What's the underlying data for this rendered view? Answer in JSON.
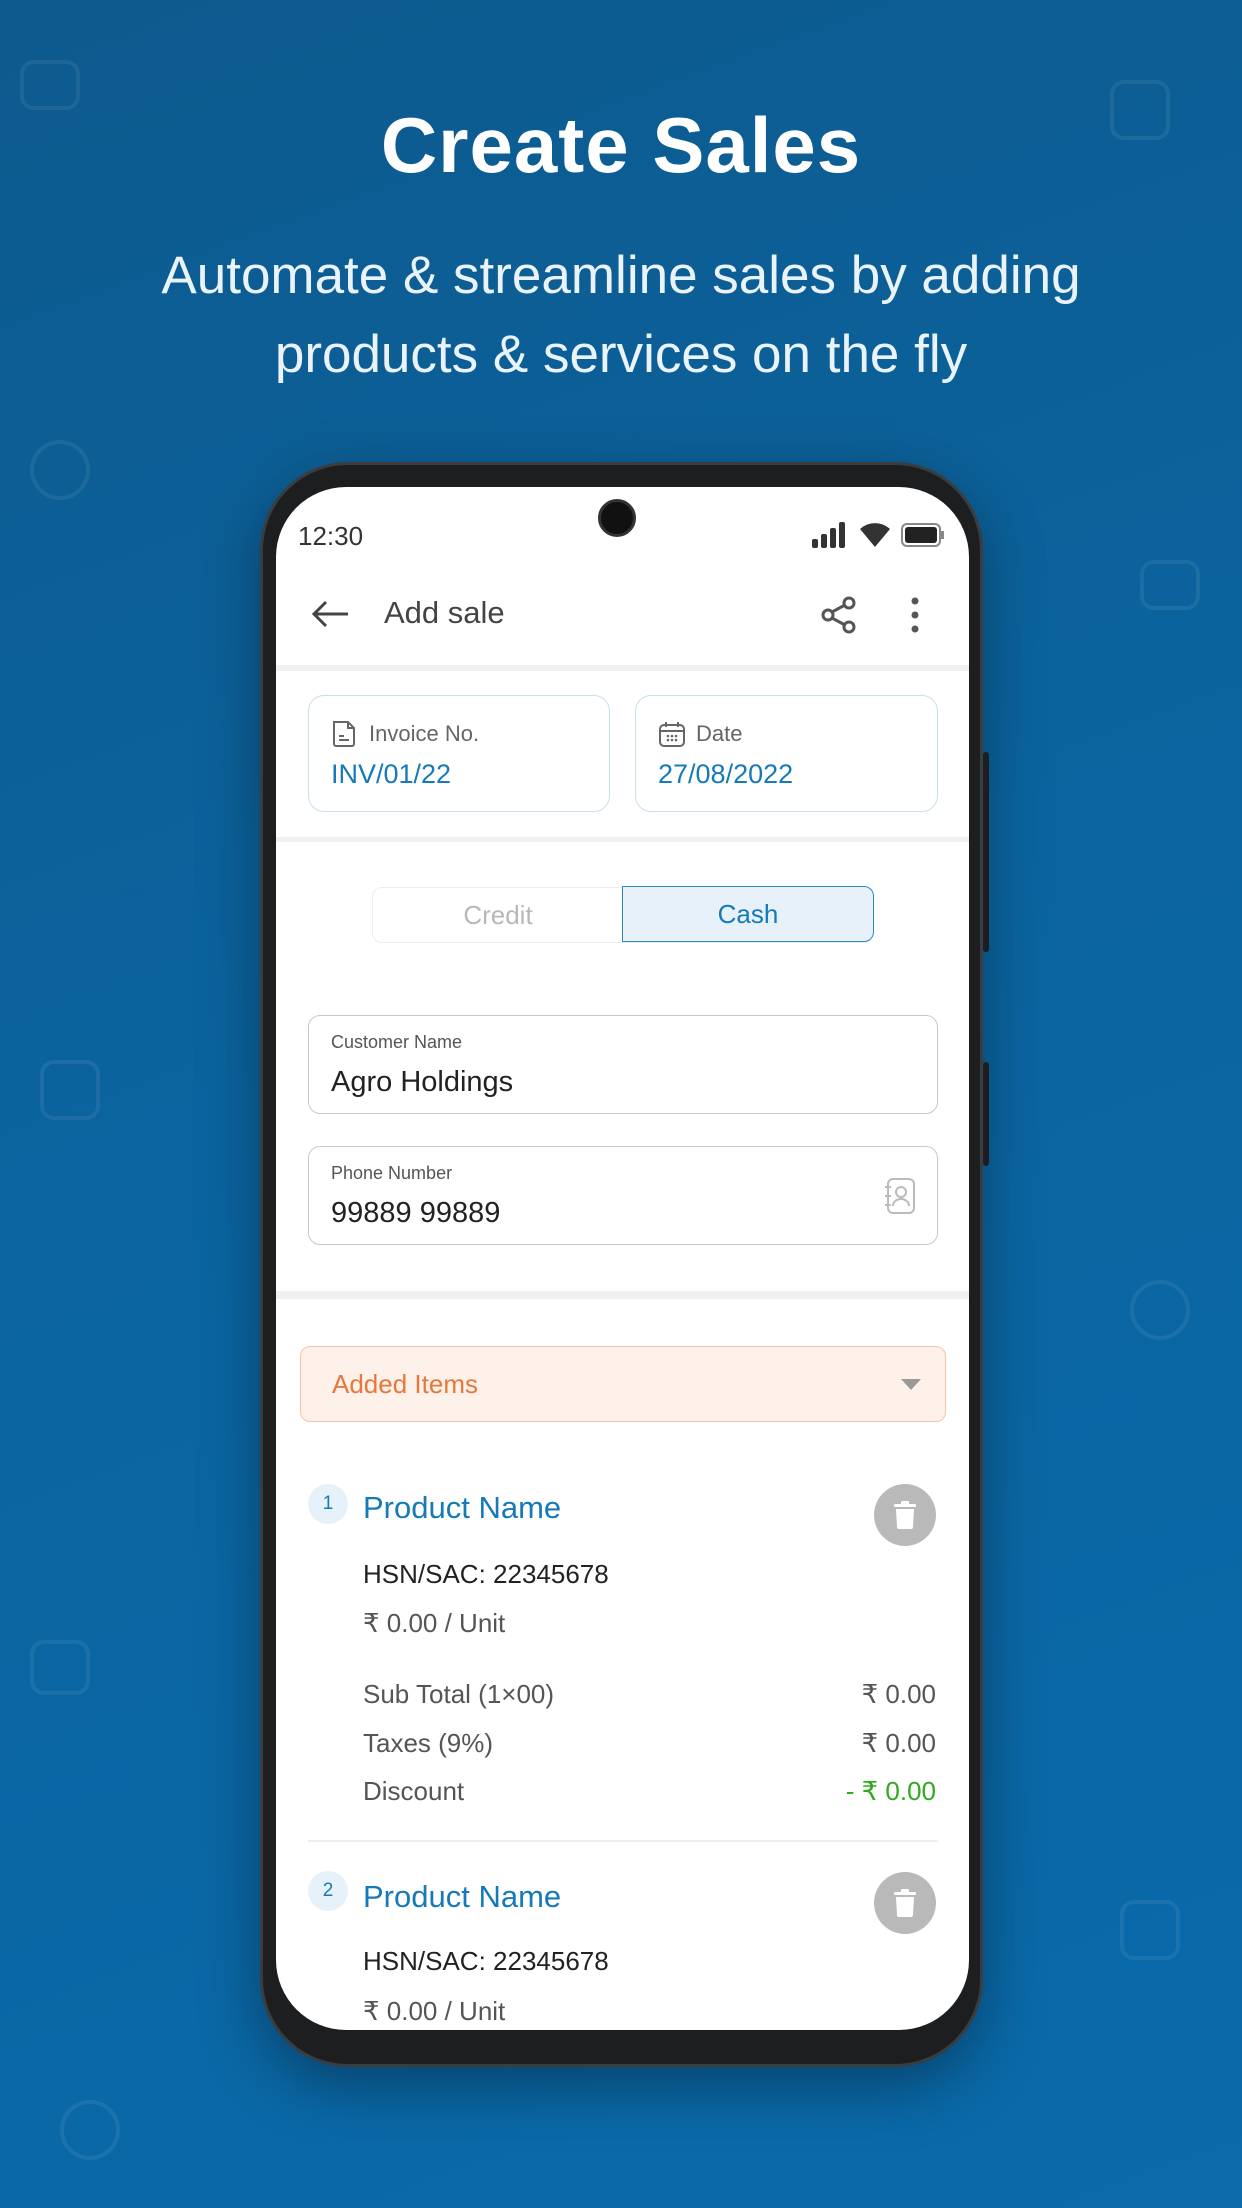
{
  "hero": {
    "title": "Create Sales",
    "subtitle_line1": "Automate & streamline sales by adding",
    "subtitle_line2": "products & services on the fly"
  },
  "status_bar": {
    "time": "12:30",
    "icons": [
      "signal-icon",
      "wifi-icon",
      "battery-icon"
    ]
  },
  "app_bar": {
    "title": "Add sale",
    "icons": [
      "back-arrow-icon",
      "share-icon",
      "more-vert-icon"
    ]
  },
  "invoice": {
    "label": "Invoice No.",
    "value": "INV/01/22"
  },
  "date": {
    "label": "Date",
    "value": "27/08/2022"
  },
  "payment_toggle": {
    "options": [
      "Credit",
      "Cash"
    ],
    "selected": "Cash"
  },
  "customer": {
    "label": "Customer Name",
    "value": "Agro Holdings"
  },
  "phone": {
    "label": "Phone Number",
    "value": "99889 99889"
  },
  "added_items": {
    "label": "Added Items"
  },
  "items": [
    {
      "index": "1",
      "name": "Product Name",
      "hsn": "HSN/SAC: 22345678",
      "price": "₹ 0.00 / Unit",
      "subtotal_label": "Sub Total (1×00)",
      "subtotal": "₹  0.00",
      "taxes_label": "Taxes (9%)",
      "taxes": "₹  0.00",
      "discount_label": "Discount",
      "discount": "- ₹  0.00"
    },
    {
      "index": "2",
      "name": "Product Name",
      "hsn": "HSN/SAC: 22345678",
      "price": "₹ 0.00 / Unit"
    }
  ],
  "colors": {
    "accent": "#1679b8",
    "discount": "#2faa1e",
    "added_items": "#e8773b",
    "background": "#0b649f"
  }
}
